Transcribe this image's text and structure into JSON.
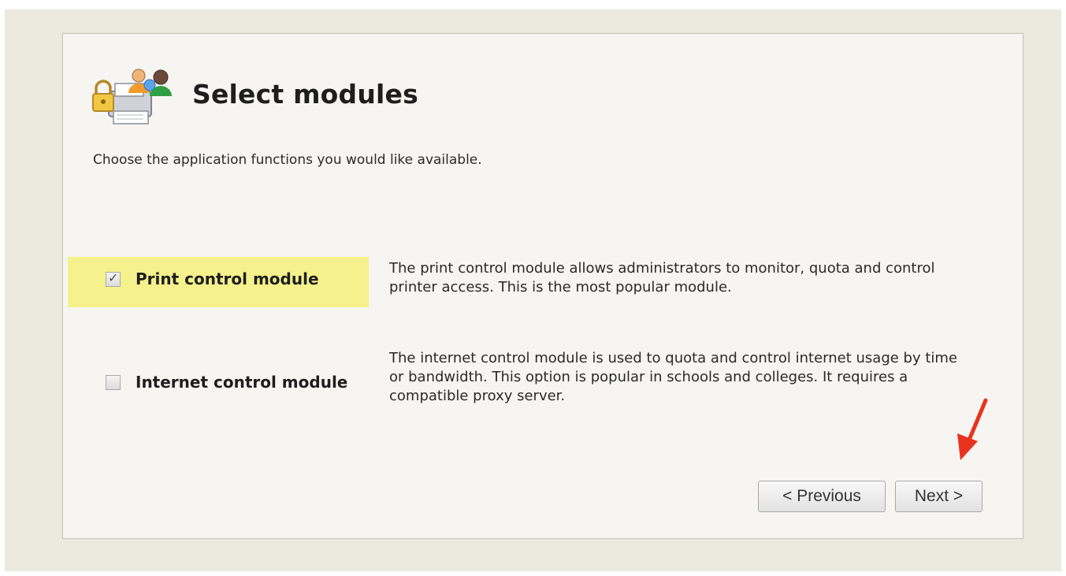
{
  "page": {
    "title": "Select modules",
    "subtitle": "Choose the application functions you would like available."
  },
  "modules": [
    {
      "label": "Print control module",
      "checked": true,
      "highlighted": true,
      "description": "The print control module allows administrators to monitor, quota and control printer access. This is the most popular module."
    },
    {
      "label": "Internet control module",
      "checked": false,
      "highlighted": false,
      "description": "The internet control module is used to quota and control internet usage by time or bandwidth. This option is popular in schools and colleges. It requires a compatible proxy server."
    }
  ],
  "buttons": {
    "previous": "< Previous",
    "next": "Next >"
  },
  "icons": {
    "header": "users-printer-lock-icon",
    "annotation": "red-arrow-icon"
  },
  "colors": {
    "highlight": "#f5f18c",
    "arrow": "#e8331f",
    "background": "#ece9df",
    "panel": "#f6f5f1"
  }
}
